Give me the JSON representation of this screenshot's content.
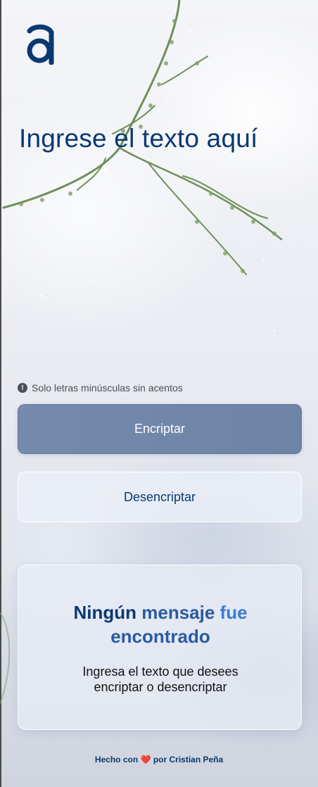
{
  "app": {
    "logo_letter": "a"
  },
  "main": {
    "title": "Ingrese el texto aquí",
    "hint_icon": "!",
    "hint": "Solo letras minúsculas sin acentos"
  },
  "buttons": {
    "encrypt_label": "Encriptar",
    "decrypt_label": "Desencriptar"
  },
  "result": {
    "title_part1": "Ningún ",
    "title_part2": "mensaje ",
    "title_part3": "fue",
    "title_part4": "encontrado",
    "message_line1": "Ingresa el texto que desees",
    "message_line2": "encriptar o desencriptar"
  },
  "footer": {
    "prefix": "Hecho con",
    "heart": "❤️",
    "suffix": "por Cristian Peña"
  },
  "colors": {
    "primary": "#0a3871",
    "accent": "#3a7bd5",
    "heart": "#e0245e"
  }
}
